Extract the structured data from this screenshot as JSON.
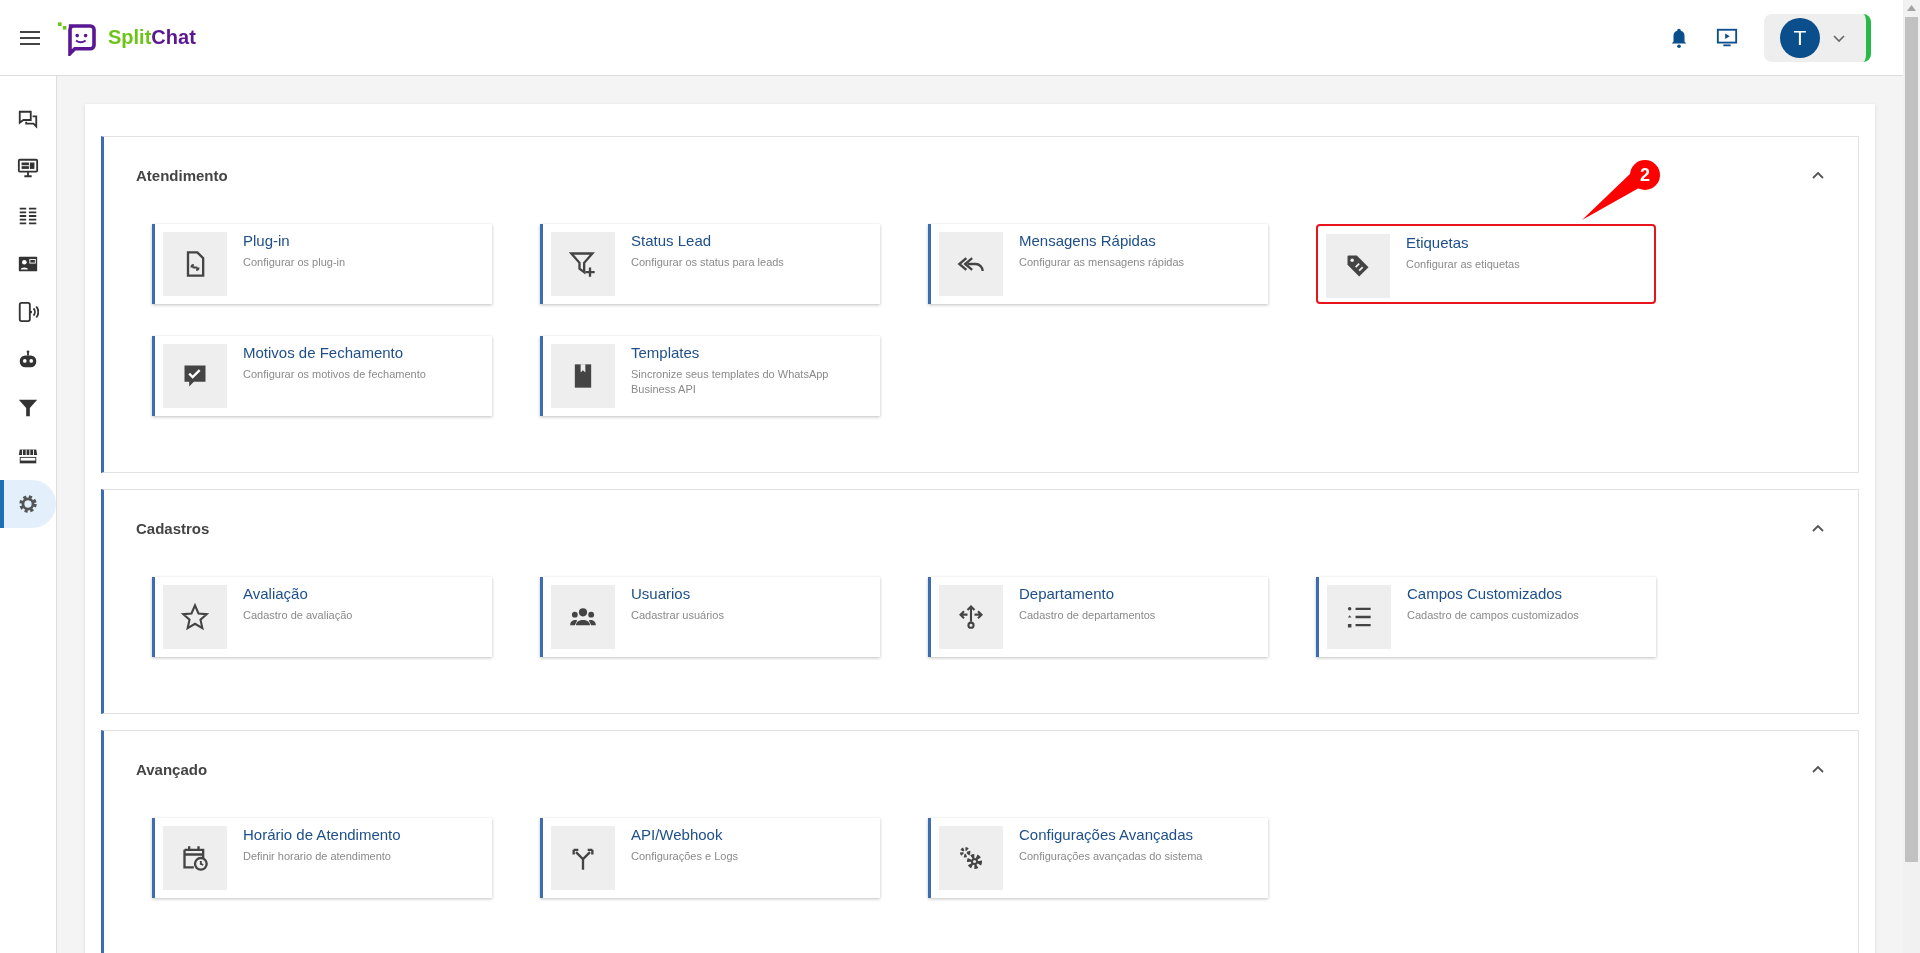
{
  "header": {
    "logo_text": [
      "Split",
      "Chat"
    ],
    "avatar_initial": "T"
  },
  "sidebar": {
    "items": [
      {
        "selected": false
      },
      {
        "selected": false
      },
      {
        "selected": false
      },
      {
        "selected": false
      },
      {
        "selected": false
      },
      {
        "selected": false
      },
      {
        "selected": false
      },
      {
        "selected": false
      },
      {
        "selected": true
      }
    ]
  },
  "sections": [
    {
      "title": "Atendimento",
      "expanded": true,
      "cards": [
        {
          "title": "Plug-in",
          "description": "Configurar os plug-in",
          "highlighted": false
        },
        {
          "title": "Status Lead",
          "description": "Configurar os status para leads",
          "highlighted": false
        },
        {
          "title": "Mensagens Rápidas",
          "description": "Configurar as mensagens rápidas",
          "highlighted": false
        },
        {
          "title": "Etiquetas",
          "description": "Configurar as etiquetas",
          "highlighted": true,
          "callout": "2"
        },
        {
          "title": "Motivos de Fechamento",
          "description": "Configurar os motivos de fechamento",
          "highlighted": false
        },
        {
          "title": "Templates",
          "description": "Sincronize seus templates do WhatsApp Business API",
          "highlighted": false
        }
      ]
    },
    {
      "title": "Cadastros",
      "expanded": true,
      "cards": [
        {
          "title": "Avaliação",
          "description": "Cadastro de avaliação",
          "highlighted": false
        },
        {
          "title": "Usuarios",
          "description": "Cadastrar usuários",
          "highlighted": false
        },
        {
          "title": "Departamento",
          "description": "Cadastro de departamentos",
          "highlighted": false
        },
        {
          "title": "Campos Customizados",
          "description": "Cadastro de campos customizados",
          "highlighted": false
        }
      ]
    },
    {
      "title": "Avançado",
      "expanded": true,
      "cards": [
        {
          "title": "Horário de Atendimento",
          "description": "Definir horario de atendimento",
          "highlighted": false
        },
        {
          "title": "API/Webhook",
          "description": "Configurações e Logs",
          "highlighted": false
        },
        {
          "title": "Configurações Avançadas",
          "description": "Configurações avançadas do sistema",
          "highlighted": false
        }
      ]
    }
  ]
}
